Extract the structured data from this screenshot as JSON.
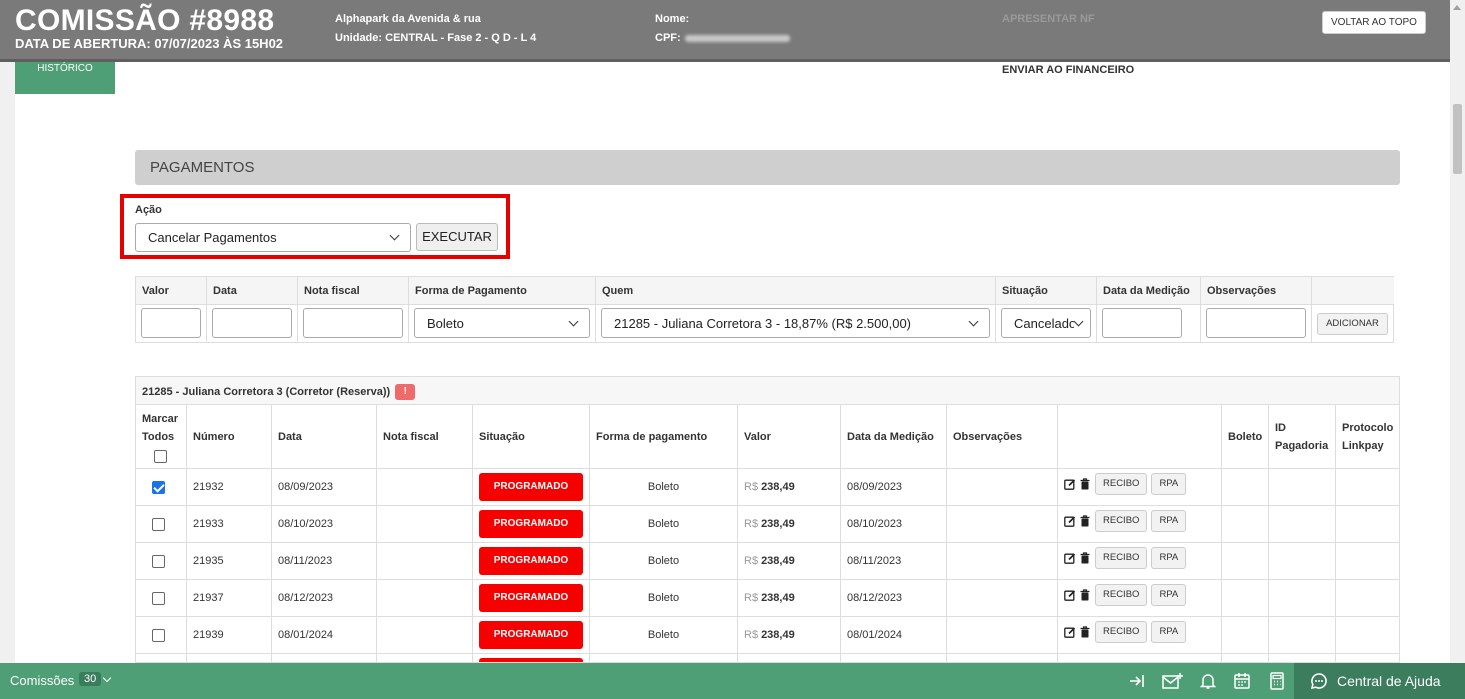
{
  "header": {
    "title": "COMISSÃO #8988",
    "subtitle": "DATA DE ABERTURA: 07/07/2023 ÀS 15H02",
    "empreendimento": "Alphapark da Avenida & rua",
    "unidade_label": "Unidade:",
    "unidade_value": "CENTRAL - Fase 2 - Q D - L 4",
    "nome_label": "Nome:",
    "cpf_label": "CPF:",
    "apresentar_nf": "APRESENTAR NF",
    "voltar_topo": "VOLTAR AO TOPO"
  },
  "historico": "HISTÓRICO",
  "enviar_financeiro": "ENVIAR AO FINANCEIRO",
  "pagamentos": {
    "title": "PAGAMENTOS",
    "acao_label": "Ação",
    "acao_value": "Cancelar Pagamentos",
    "executar": "EXECUTAR"
  },
  "add_form": {
    "headers": [
      "Valor",
      "Data",
      "Nota fiscal",
      "Forma de Pagamento",
      "Quem",
      "Situação",
      "Data da Medição",
      "Observações"
    ],
    "forma_value": "Boleto",
    "quem_value": "21285 - Juliana Corretora 3 - 18,87% (R$ 2.500,00)",
    "situacao_value": "Cancelado",
    "adicionar": "ADICIONAR"
  },
  "group": {
    "title": "21285 - Juliana Corretora 3 (Corretor (Reserva))",
    "badge": "!"
  },
  "table": {
    "headers": {
      "marcar": "Marcar Todos",
      "numero": "Número",
      "data": "Data",
      "nota": "Nota fiscal",
      "situacao": "Situação",
      "forma": "Forma de pagamento",
      "valor": "Valor",
      "medicao": "Data da Medição",
      "obs": "Observações",
      "acoes": "",
      "boleto": "Boleto",
      "id_pagadoria": "ID Pagadoria",
      "protocolo": "Protocolo Linkpay"
    },
    "currency": "R$",
    "recibo": "RECIBO",
    "rpa": "RPA",
    "rows": [
      {
        "checked": true,
        "numero": "21932",
        "data": "08/09/2023",
        "situacao": "PROGRAMADO",
        "forma": "Boleto",
        "valor": "238,49",
        "medicao": "08/09/2023"
      },
      {
        "checked": false,
        "numero": "21933",
        "data": "08/10/2023",
        "situacao": "PROGRAMADO",
        "forma": "Boleto",
        "valor": "238,49",
        "medicao": "08/10/2023"
      },
      {
        "checked": false,
        "numero": "21935",
        "data": "08/11/2023",
        "situacao": "PROGRAMADO",
        "forma": "Boleto",
        "valor": "238,49",
        "medicao": "08/11/2023"
      },
      {
        "checked": false,
        "numero": "21937",
        "data": "08/12/2023",
        "situacao": "PROGRAMADO",
        "forma": "Boleto",
        "valor": "238,49",
        "medicao": "08/12/2023"
      },
      {
        "checked": false,
        "numero": "21939",
        "data": "08/01/2024",
        "situacao": "PROGRAMADO",
        "forma": "Boleto",
        "valor": "238,49",
        "medicao": "08/01/2024"
      },
      {
        "checked": false,
        "numero": "",
        "data": "",
        "situacao": "",
        "forma": "",
        "valor": "",
        "medicao": ""
      }
    ]
  },
  "bottombar": {
    "comissoes_label": "Comissões",
    "comissoes_count": "30",
    "central_ajuda": "Central de Ajuda"
  }
}
